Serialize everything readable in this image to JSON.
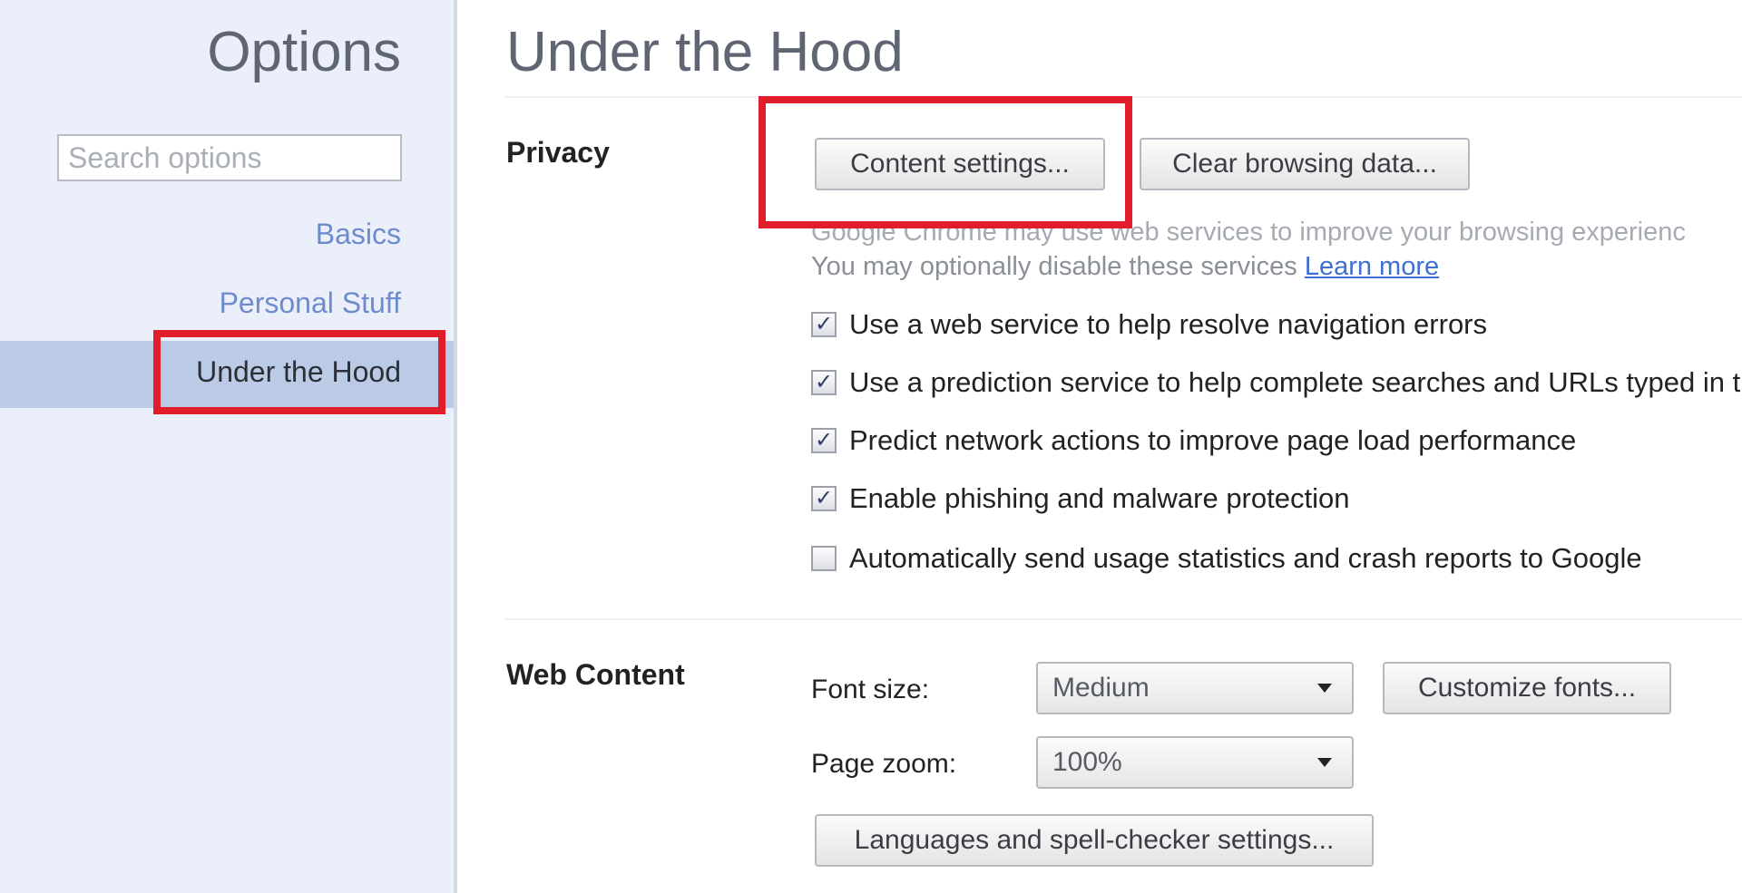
{
  "sidebar": {
    "title": "Options",
    "search_placeholder": "Search options",
    "items": [
      {
        "label": "Basics",
        "selected": false
      },
      {
        "label": "Personal Stuff",
        "selected": false
      },
      {
        "label": "Under the Hood",
        "selected": true
      }
    ]
  },
  "main": {
    "title": "Under the Hood",
    "privacy": {
      "label": "Privacy",
      "content_settings_button": "Content settings...",
      "clear_browsing_button": "Clear browsing data...",
      "info_line1": "Google Chrome may use web services to improve your browsing experienc",
      "info_line2": "You may optionally disable these services",
      "learn_more": "Learn more",
      "checkboxes": [
        {
          "label": "Use a web service to help resolve navigation errors",
          "checked": true
        },
        {
          "label": "Use a prediction service to help complete searches and URLs typed in t",
          "checked": true
        },
        {
          "label": "Predict network actions to improve page load performance",
          "checked": true
        },
        {
          "label": "Enable phishing and malware protection",
          "checked": true
        },
        {
          "label": "Automatically send usage statistics and crash reports to Google",
          "checked": false
        }
      ]
    },
    "web_content": {
      "label": "Web Content",
      "font_size_label": "Font size:",
      "font_size_value": "Medium",
      "customize_fonts_button": "Customize fonts...",
      "page_zoom_label": "Page zoom:",
      "page_zoom_value": "100%",
      "languages_button": "Languages and spell-checker settings..."
    }
  },
  "colors": {
    "highlight": "#e21d2b",
    "sidebar_bg": "#ebeff9",
    "selected_bg": "#bccbe5",
    "link": "#3f6fd1"
  }
}
